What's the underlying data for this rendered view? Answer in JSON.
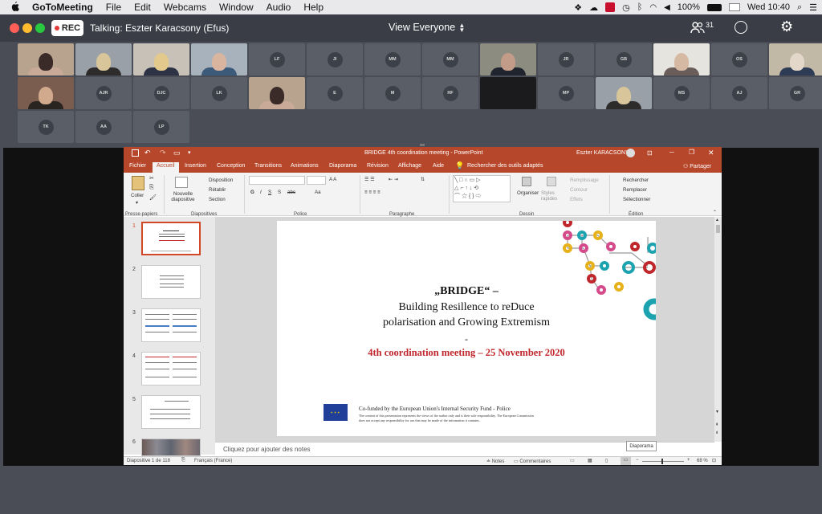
{
  "menubar": {
    "apple": "",
    "items": [
      "GoToMeeting",
      "File",
      "Edit",
      "Webcams",
      "Window",
      "Audio",
      "Help"
    ],
    "battery": "100%",
    "clock": "Wed 10:40"
  },
  "toolbar": {
    "rec_label": "REC",
    "talking": "Talking: Eszter Karacsony (Efus)",
    "view_label": "View Everyone",
    "attendee_count": "31"
  },
  "webcams": {
    "row1": [
      "video",
      "video",
      "video",
      "video",
      "LF",
      "JI",
      "MM",
      "MM",
      "video",
      "JR",
      "GB",
      "video",
      "OS",
      "video"
    ],
    "row2": [
      "video",
      "AJR",
      "DJC",
      "LK",
      "video",
      "E",
      "M",
      "HF",
      "dark",
      "MP",
      "video",
      "MS",
      "AJ",
      "GR"
    ],
    "row3": [
      "TK",
      "AA",
      "LP"
    ]
  },
  "ppt": {
    "title": "BRIDGE 4th coordination meeting  -  PowerPoint",
    "user": "Eszter KARACSONY",
    "tabs": [
      "Fichier",
      "Accueil",
      "Insertion",
      "Conception",
      "Transitions",
      "Animations",
      "Diaporama",
      "Révision",
      "Affichage",
      "Aide"
    ],
    "search": "Rechercher des outils adaptés",
    "share": "Partager",
    "ribbon": {
      "paste": "Coller",
      "new_slide": "Nouvelle diapositive",
      "disposition": "Disposition",
      "retablir": "Rétablir",
      "section": "Section",
      "organiser": "Organiser",
      "styles": "Styles rapides",
      "remplissage": "Remplissage",
      "contour": "Contour",
      "effets": "Effets",
      "rechercher": "Rechercher",
      "remplacer": "Remplacer",
      "selectionner": "Sélectionner",
      "groups": [
        "Presse-papiers",
        "Diapositives",
        "Police",
        "Paragraphe",
        "Dessin",
        "Édition"
      ]
    },
    "slide": {
      "title": "„BRIDGE“ –",
      "subtitle1": "Building Resillence to reDuce",
      "subtitle2": "polarisation and Growing Extremism",
      "dash": "-",
      "meeting": "4th coordination meeting – 25 November 2020",
      "cofund": "Co-funded by the European Union's Internal Security Fund - Police",
      "disclaimer1": "The content of this presentation represents the views of the author only and is their sole responsibility. The European Commission",
      "disclaimer2": "does not accept any responsibility for use that may be made of the information it contains."
    },
    "thumb_numbers": [
      "1",
      "2",
      "3",
      "4",
      "5",
      "6"
    ],
    "notes_placeholder": "Cliquez pour ajouter des notes",
    "status": {
      "slide_count": "Diapositive 1 de 118",
      "language": "Français (France)",
      "notes": "Notes",
      "comments": "Commentaires",
      "zoom": "68 %"
    },
    "tooltip": "Diaporama"
  },
  "colors": {
    "accent": "#b7472a",
    "meeting_red": "#c0272d",
    "toolbar_bg": "#3a3d45"
  }
}
